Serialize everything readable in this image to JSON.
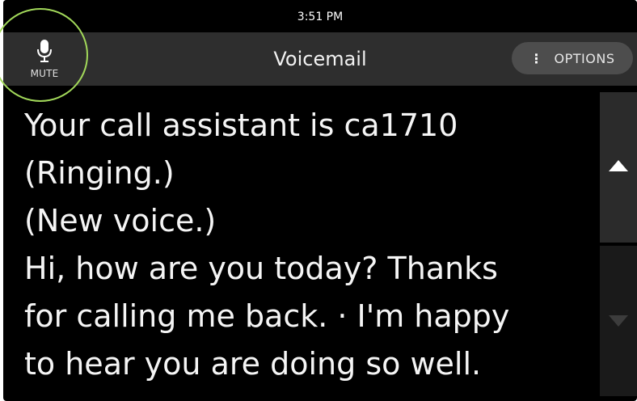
{
  "status_bar": {
    "time": "3:51 PM"
  },
  "header": {
    "title": "Voicemail",
    "mute": {
      "label": "MUTE",
      "icon": "microphone-icon"
    },
    "options": {
      "label": "OPTIONS",
      "icon": "vertical-dots-icon",
      "icon_glyph": "⋮"
    }
  },
  "transcript": {
    "lines": [
      "Your call assistant is ca1710",
      "(Ringing.)",
      "(New voice.)",
      "Hi, how are you today? Thanks",
      "for calling me back. · I'm happy",
      "to hear you are doing so well."
    ]
  },
  "scrollbar": {
    "up_icon": "arrow-up-icon",
    "down_icon": "arrow-down-icon",
    "down_enabled": false
  },
  "colors": {
    "background": "#000000",
    "header_background": "#2e2e2e",
    "options_button": "#4d4d4d",
    "highlight_ring": "#a2d85a"
  }
}
